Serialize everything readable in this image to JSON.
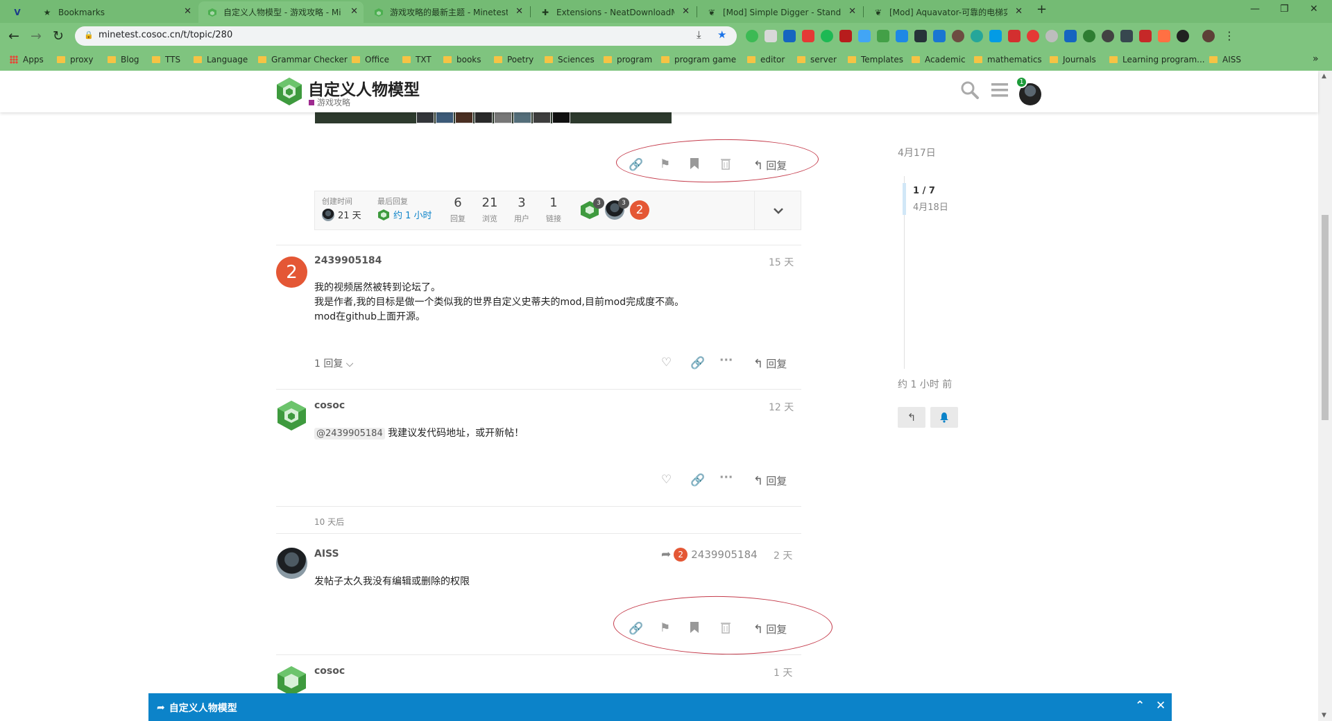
{
  "browser": {
    "tabs": [
      {
        "label": "Bookmarks",
        "favicon": "star-icon"
      },
      {
        "label": "自定义人物模型 - 游戏攻略 - Min",
        "favicon": "minetest-cube-icon"
      },
      {
        "label": "游戏攻略的最新主题 - Minetest中",
        "favicon": "minetest-cube-icon"
      },
      {
        "label": "Extensions - NeatDownloadMana",
        "favicon": "puzzle-icon"
      },
      {
        "label": "[Mod] Simple Digger - Standalon",
        "favicon": "forum-icon"
      },
      {
        "label": "[Mod] Aquavator-可靠的电梯实现",
        "favicon": "forum-icon"
      }
    ],
    "url": "minetest.cosoc.cn/t/topic/280",
    "bookmarks": [
      "Apps",
      "proxy",
      "Blog",
      "TTS",
      "Language",
      "Grammar Checker",
      "Office",
      "TXT",
      "books",
      "Poetry",
      "Sciences",
      "program",
      "program game",
      "editor",
      "server",
      "Templates",
      "Academic",
      "mathematics",
      "Journals",
      "Learning program...",
      "AISS"
    ],
    "bookmarks_more": "»"
  },
  "header": {
    "title": "自定义人物模型",
    "category": "游戏攻略",
    "notification_count": "1",
    "category_color": "#9e2a8f"
  },
  "post_actions": {
    "reply_label": "回复"
  },
  "topic_map": {
    "created_label": "创建时间",
    "created_value": "21 天",
    "last_reply_label": "最后回复",
    "last_reply_value": "约 1 小时",
    "stats": [
      {
        "value": "6",
        "label": "回复"
      },
      {
        "value": "21",
        "label": "浏览"
      },
      {
        "value": "3",
        "label": "用户"
      },
      {
        "value": "1",
        "label": "链接"
      }
    ],
    "participants": [
      {
        "count": "3",
        "avatar": "cube"
      },
      {
        "count": "3",
        "avatar": "photo"
      },
      {
        "count": "",
        "avatar": "letter",
        "letter": "2"
      }
    ]
  },
  "posts": [
    {
      "username": "2439905184",
      "avatar_letter": "2",
      "date": "15 天",
      "lines": [
        "我的视频居然被转到论坛了。",
        "我是作者,我的目标是做一个类似我的世界自定义史蒂夫的mod,目前mod完成度不高。",
        "mod在github上面开源。"
      ],
      "reply_count": "1 回复 ⌵"
    },
    {
      "username": "cosoc",
      "date": "12 天",
      "mention": "@2439905184",
      "text": "我建议发代码地址，或开新帖！"
    },
    {
      "gap_label": "10 天后"
    },
    {
      "username": "AISS",
      "date": "2 天",
      "reply_to_letter": "2",
      "reply_to": "2439905184",
      "text": "发帖子太久我没有编辑或删除的权限"
    },
    {
      "username": "cosoc",
      "date": "1 天"
    }
  ],
  "timeline": {
    "start_date": "4月17日",
    "position": "1 / 7",
    "position_date": "4月18日",
    "end_label": "约 1 小时 前"
  },
  "composer": {
    "title": "自定义人物模型"
  },
  "colors": {
    "accent_blue": "#0c83c9",
    "letter_avatar": "#e45735",
    "annotation_red": "#c43a4a",
    "browser_green": "#7fc47f"
  }
}
